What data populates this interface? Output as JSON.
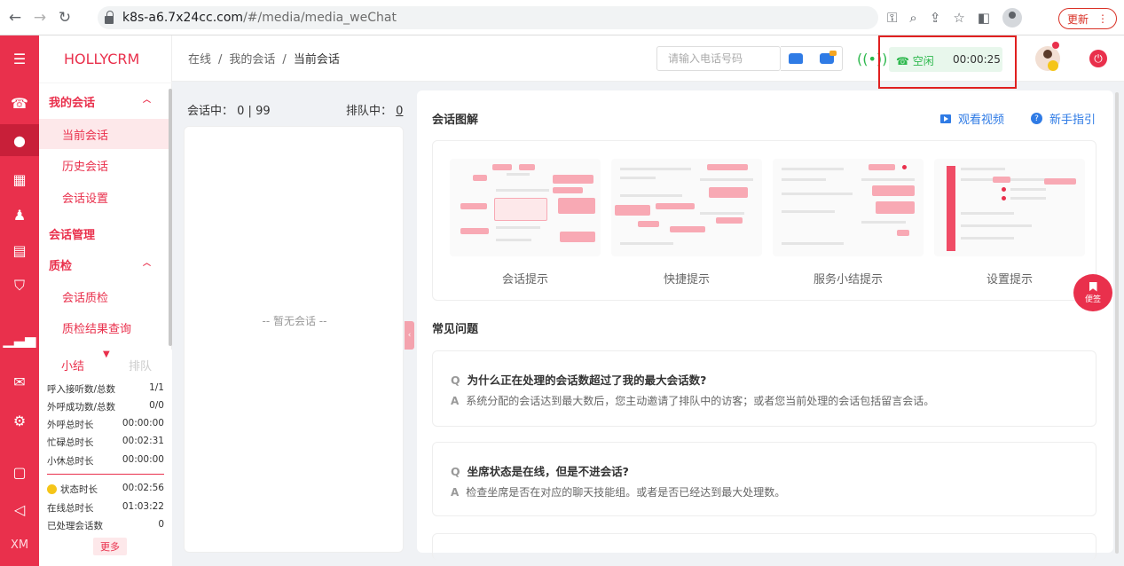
{
  "browser": {
    "url_host": "k8s-a6.7x24cc.com",
    "url_path": "/#/media/media_weChat",
    "update_label": "更新"
  },
  "rail": {
    "bottom_text": "XM",
    "icons": [
      "menu-icon",
      "phone-icon",
      "chat-icon",
      "grid-icon",
      "person-icon",
      "clipboard-icon",
      "shield-icon",
      "bar-chart-icon",
      "message-icon",
      "gear-icon",
      "book-icon",
      "megaphone-icon"
    ]
  },
  "sidebar": {
    "logo": "HOLLYCRM",
    "groups": [
      {
        "label": "我的会话",
        "items": [
          "当前会话",
          "历史会话",
          "会话设置"
        ]
      },
      {
        "label": "会话管理"
      },
      {
        "label": "质检",
        "items": [
          "会话质检",
          "质检结果查询"
        ]
      }
    ],
    "stats": {
      "tab_active": "小结",
      "tab_inactive": "排队",
      "rows": [
        {
          "label": "呼入接听数/总数",
          "value": "1/1"
        },
        {
          "label": "外呼成功数/总数",
          "value": "0/0"
        },
        {
          "label": "外呼总时长",
          "value": "00:00:00"
        },
        {
          "label": "忙碌总时长",
          "value": "00:02:31"
        },
        {
          "label": "小休总时长",
          "value": "00:00:00"
        }
      ],
      "rows2": [
        {
          "label": "状态时长",
          "value": "00:02:56"
        },
        {
          "label": "在线总时长",
          "value": "01:03:22"
        },
        {
          "label": "已处理会话数",
          "value": "0"
        }
      ],
      "more_label": "更多"
    }
  },
  "header": {
    "breadcrumb": [
      "在线",
      "我的会话",
      "当前会话"
    ],
    "phone_placeholder": "请输入电话号码",
    "status_label": "空闲",
    "status_timer": "00:00:25"
  },
  "session_list": {
    "active_label": "会话中：",
    "active_value": "0 | 99",
    "queue_label": "排队中：",
    "queue_value": "0",
    "empty": "-- 暂无会话 --"
  },
  "main": {
    "diagram_title": "会话图解",
    "video_link": "观看视频",
    "guide_link": "新手指引",
    "thumbnails": [
      "会话提示",
      "快捷提示",
      "服务小结提示",
      "设置提示"
    ],
    "faq_title": "常见问题",
    "faqs": [
      {
        "q": "为什么正在处理的会话数超过了我的最大会话数?",
        "a": "系统分配的会话达到最大数后，您主动邀请了排队中的访客；或者您当前处理的会话包括留言会话。"
      },
      {
        "q": "坐席状态是在线，但是不进会话?",
        "a": "检查坐席是否在对应的聊天技能组。或者是否已经达到最大处理数。"
      }
    ],
    "q_mark": "Q",
    "a_mark": "A"
  },
  "sticky_label": "便签",
  "colors": {
    "brand": "#e9304c",
    "status_green": "#2db84d",
    "link_blue": "#2f7be5"
  }
}
